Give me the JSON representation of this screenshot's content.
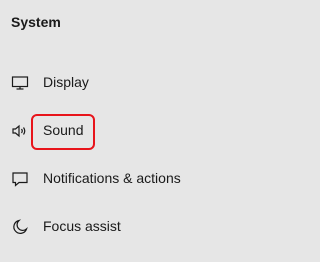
{
  "section": {
    "title": "System"
  },
  "nav": {
    "items": [
      {
        "label": "Display",
        "icon": "monitor-icon"
      },
      {
        "label": "Sound",
        "icon": "speaker-icon",
        "highlighted": true
      },
      {
        "label": "Notifications & actions",
        "icon": "notification-icon"
      },
      {
        "label": "Focus assist",
        "icon": "moon-icon"
      }
    ]
  },
  "colors": {
    "background": "#e6e6e6",
    "text": "#1a1a1a",
    "highlight_border": "#e8141b"
  }
}
